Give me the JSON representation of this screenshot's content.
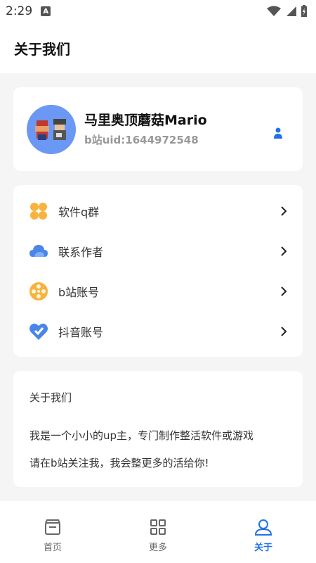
{
  "status_bar": {
    "time": "2:29",
    "notification_letter": "A"
  },
  "header": {
    "title": "关于我们"
  },
  "profile": {
    "name": "马里奥顶蘑菇Mario",
    "uid": "b站uid:1644972548",
    "avatar_icon": "mario-avatar",
    "action_icon": "person-icon"
  },
  "menu": {
    "items": [
      {
        "label": "软件q群",
        "icon": "four-petal-icon",
        "color": "#f7b33d"
      },
      {
        "label": "联系作者",
        "icon": "cloud-icon",
        "color": "#4a86e8"
      },
      {
        "label": "b站账号",
        "icon": "film-reel-icon",
        "color": "#f7b33d"
      },
      {
        "label": "抖音账号",
        "icon": "heart-icon",
        "color": "#4a86e8"
      }
    ]
  },
  "about": {
    "title": "关于我们",
    "line1": "我是一个小小的up主，专门制作整活软件或游戏",
    "line2": "请在b站关注我，我会整更多的活给你!"
  },
  "nav": {
    "items": [
      {
        "label": "首页",
        "icon": "home-icon",
        "active": false
      },
      {
        "label": "更多",
        "icon": "grid-icon",
        "active": false
      },
      {
        "label": "关于",
        "icon": "user-icon",
        "active": true
      }
    ]
  },
  "colors": {
    "accent": "#1f72e6",
    "background": "#f5f5f5",
    "card": "#ffffff",
    "muted": "#999999"
  }
}
